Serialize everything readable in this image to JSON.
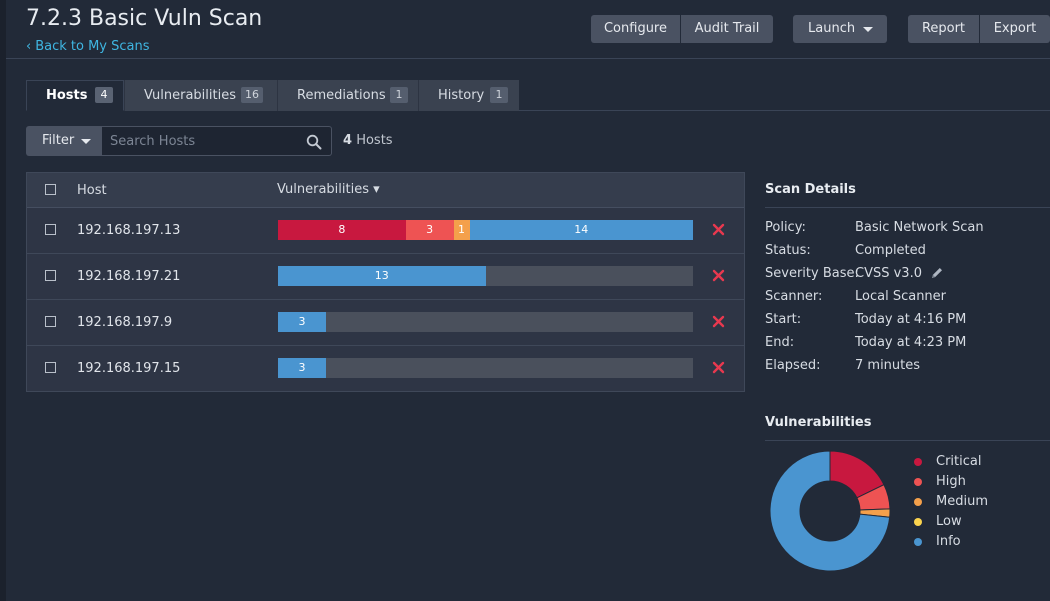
{
  "header": {
    "title": "7.2.3 Basic Vuln Scan",
    "back_link": "Back to My Scans",
    "buttons": {
      "configure": "Configure",
      "audit_trail": "Audit Trail",
      "launch": "Launch",
      "report": "Report",
      "export": "Export"
    }
  },
  "tabs": [
    {
      "label": "Hosts",
      "count": "4",
      "active": true
    },
    {
      "label": "Vulnerabilities",
      "count": "16"
    },
    {
      "label": "Remediations",
      "count": "1"
    },
    {
      "label": "History",
      "count": "1"
    }
  ],
  "filter": {
    "label": "Filter",
    "search_placeholder": "Search Hosts",
    "count_num": "4",
    "count_text": "Hosts"
  },
  "table": {
    "columns": {
      "host": "Host",
      "vulnerabilities": "Vulnerabilities ▾"
    },
    "rows": [
      {
        "host": "192.168.197.13",
        "severity": {
          "critical": 8,
          "high": 3,
          "medium": 1,
          "low": 0,
          "info": 14
        }
      },
      {
        "host": "192.168.197.21",
        "severity": {
          "critical": 0,
          "high": 0,
          "medium": 0,
          "low": 0,
          "info": 13
        }
      },
      {
        "host": "192.168.197.9",
        "severity": {
          "critical": 0,
          "high": 0,
          "medium": 0,
          "low": 0,
          "info": 3
        }
      },
      {
        "host": "192.168.197.15",
        "severity": {
          "critical": 0,
          "high": 0,
          "medium": 0,
          "low": 0,
          "info": 3
        }
      }
    ]
  },
  "scan_details": {
    "title": "Scan Details",
    "items": [
      {
        "label": "Policy:",
        "value": "Basic Network Scan"
      },
      {
        "label": "Status:",
        "value": "Completed"
      },
      {
        "label": "Severity Base:",
        "value": "CVSS v3.0"
      },
      {
        "label": "Scanner:",
        "value": "Local Scanner"
      },
      {
        "label": "Start:",
        "value": "Today at 4:16 PM"
      },
      {
        "label": "End:",
        "value": "Today at 4:23 PM"
      },
      {
        "label": "Elapsed:",
        "value": "7 minutes"
      }
    ]
  },
  "vulnerabilities_chart": {
    "title": "Vulnerabilities",
    "legend": [
      {
        "label": "Critical",
        "color": "#c8183f"
      },
      {
        "label": "High",
        "color": "#ee5353"
      },
      {
        "label": "Medium",
        "color": "#f4a04b"
      },
      {
        "label": "Low",
        "color": "#fbd34e"
      },
      {
        "label": "Info",
        "color": "#4a95d0"
      }
    ]
  },
  "colors": {
    "critical": "#c8183f",
    "high": "#ee5353",
    "medium": "#f4a04b",
    "low": "#fbd34e",
    "info": "#4a95d0",
    "link": "#3fb6e2",
    "remove": "#e8384f"
  }
}
